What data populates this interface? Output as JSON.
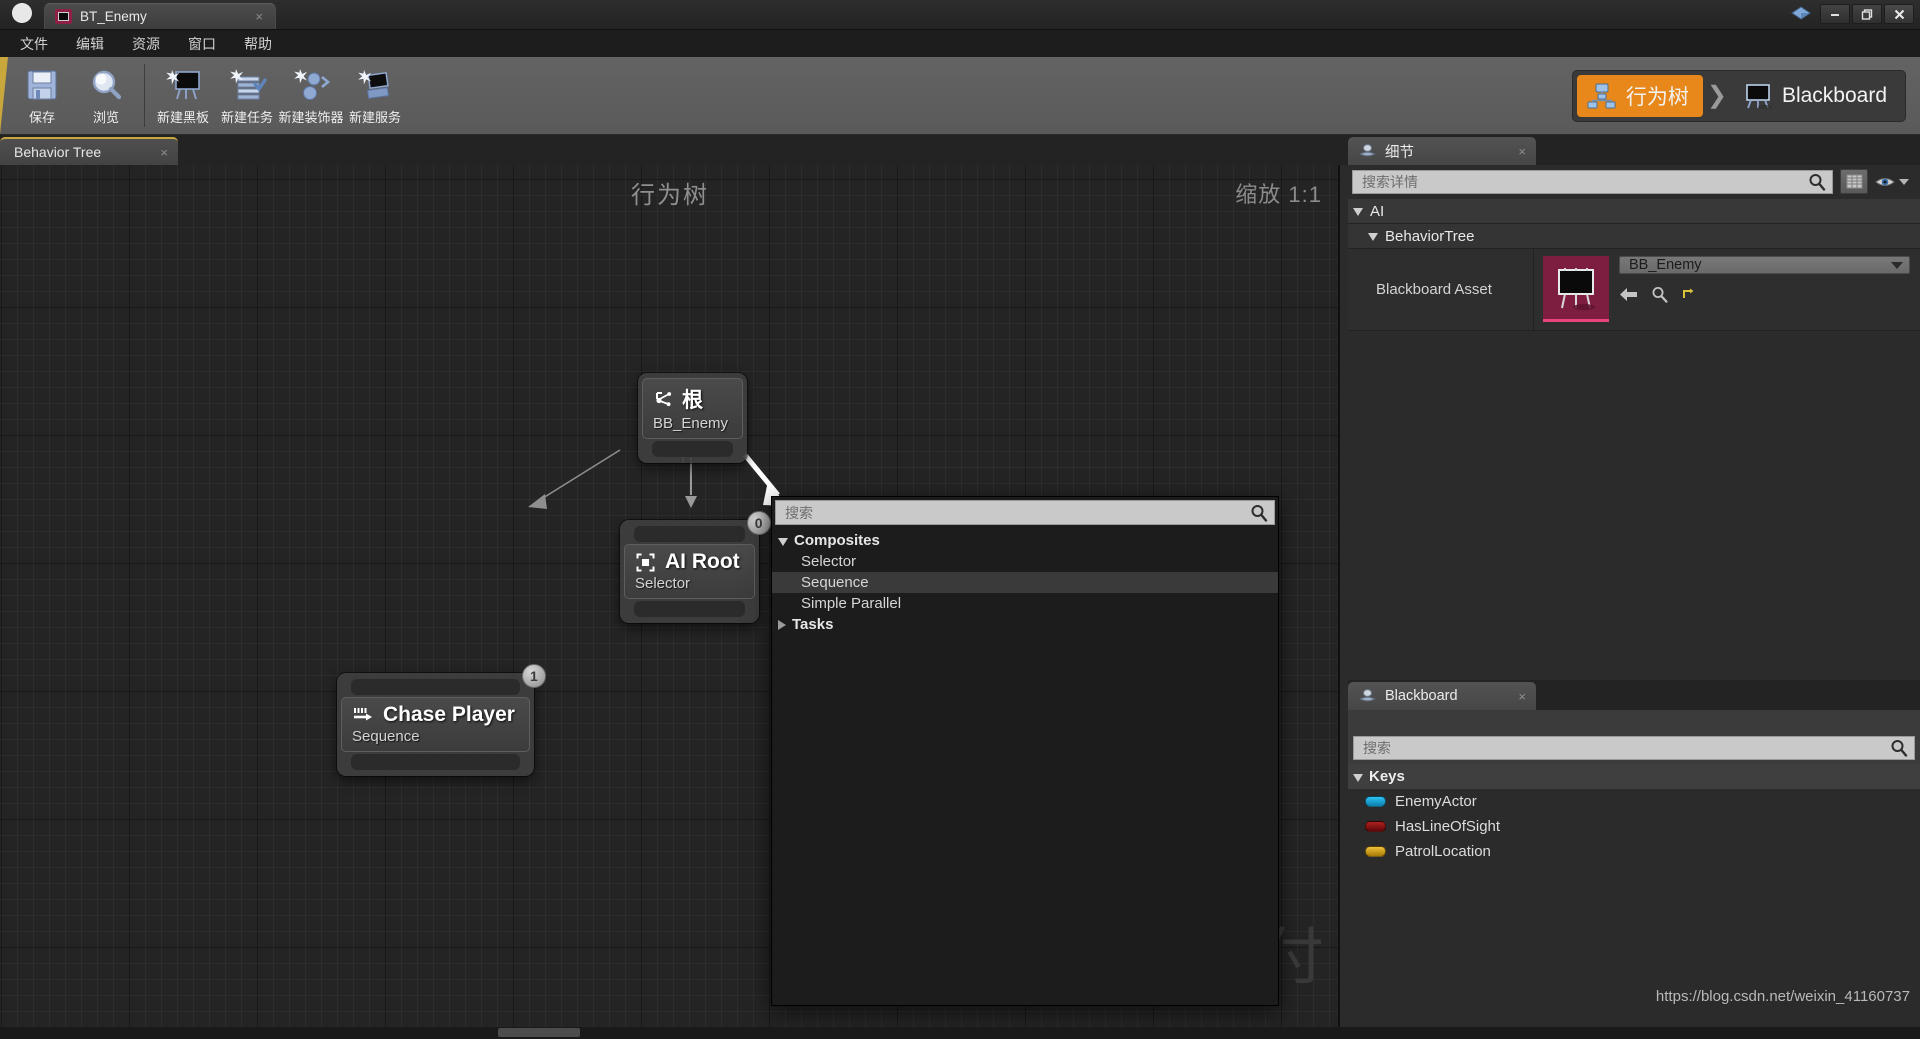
{
  "window": {
    "tab_title": "BT_Enemy",
    "tab_close": "×",
    "tab_icon": "blackboard-asset-icon",
    "minimize": "–",
    "restore": "❐",
    "close": "✕"
  },
  "menubar": {
    "items": [
      {
        "label": "文件",
        "name": "menu-file"
      },
      {
        "label": "编辑",
        "name": "menu-edit"
      },
      {
        "label": "资源",
        "name": "menu-asset"
      },
      {
        "label": "窗口",
        "name": "menu-window"
      },
      {
        "label": "帮助",
        "name": "menu-help"
      }
    ]
  },
  "toolbar": {
    "buttons": [
      {
        "label": "保存",
        "icon": "save-icon"
      },
      {
        "label": "浏览",
        "icon": "browse-icon"
      },
      {
        "label": "新建黑板",
        "icon": "new-blackboard-icon"
      },
      {
        "label": "新建任务",
        "icon": "new-task-icon"
      },
      {
        "label": "新建装饰器",
        "icon": "new-decorator-icon"
      },
      {
        "label": "新建服务",
        "icon": "new-service-icon"
      }
    ],
    "modes": {
      "behavior_tree": "行为树",
      "blackboard": "Blackboard",
      "separator": "❯",
      "active": "行为树",
      "accent_color": "#e8881a"
    }
  },
  "graph": {
    "tab_label": "Behavior Tree",
    "tab_close": "×",
    "watermark": "行为树",
    "zoom_label": "缩放 1:1",
    "corner_mark": "付",
    "nodes": [
      {
        "title": "根",
        "subtitle": "BB_Enemy",
        "icon": "root-node-icon",
        "badge": null,
        "name": "graph-node-root"
      },
      {
        "title": "AI Root",
        "subtitle": "Selector",
        "icon": "selector-node-icon",
        "badge": "0",
        "name": "graph-node-ai-root"
      },
      {
        "title": "Chase Player",
        "subtitle": "Sequence",
        "icon": "sequence-node-icon",
        "badge": "1",
        "name": "graph-node-chase-player"
      }
    ]
  },
  "context_menu": {
    "search_placeholder": "搜索",
    "search_value": "",
    "categories": [
      {
        "label": "Composites",
        "expanded": true,
        "items": [
          {
            "label": "Selector",
            "selected": false
          },
          {
            "label": "Sequence",
            "selected": true
          },
          {
            "label": "Simple Parallel",
            "selected": false
          }
        ]
      },
      {
        "label": "Tasks",
        "expanded": false,
        "items": []
      }
    ]
  },
  "details": {
    "tab_label": "细节",
    "tab_close": "×",
    "search_placeholder": "搜索详情",
    "search_value": "",
    "view_grid_icon": "grid-view-icon",
    "visibility_icon": "eye-icon",
    "visibility_caret": "chevron-down-icon",
    "categories": [
      {
        "label": "AI",
        "level": 1,
        "expanded": true
      },
      {
        "label": "BehaviorTree",
        "level": 2,
        "expanded": true
      }
    ],
    "property": {
      "label": "Blackboard Asset",
      "thumbnail": "blackboard-thumbnail",
      "value": "BB_Enemy",
      "actions": [
        {
          "icon": "back-arrow-icon",
          "name": "use-selected-asset-button"
        },
        {
          "icon": "browse-magnifier-icon",
          "name": "browse-asset-button"
        },
        {
          "icon": "reset-arrow-icon",
          "name": "reset-to-default-button"
        }
      ]
    }
  },
  "blackboard": {
    "tab_label": "Blackboard",
    "tab_close": "×",
    "search_placeholder": "搜索",
    "search_value": "",
    "keys_header": "Keys",
    "keys": [
      {
        "label": "EnemyActor",
        "color": "#14a3d6"
      },
      {
        "label": "HasLineOfSight",
        "color": "#8c1212"
      },
      {
        "label": "PatrolLocation",
        "color": "#d4a017"
      }
    ]
  },
  "footer": {
    "watermark": "https://blog.csdn.net/weixin_41160737"
  }
}
